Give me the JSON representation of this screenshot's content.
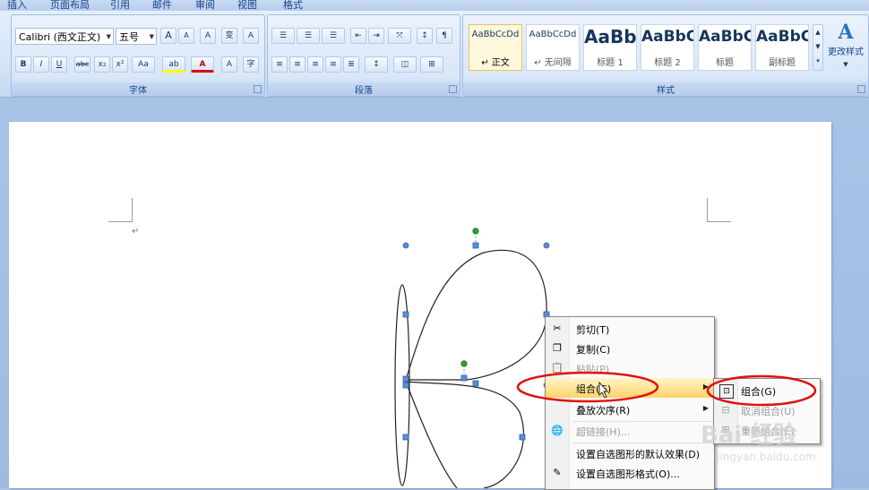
{
  "tabs": [
    "插入",
    "页面布局",
    "引用",
    "邮件",
    "审阅",
    "视图",
    "格式"
  ],
  "ribbon": {
    "font_group": {
      "title": "字体",
      "font_name": "Calibri (西文正文)",
      "font_size": "五号",
      "grow_font": "A",
      "shrink_font": "A",
      "clear_format": "A",
      "phonetic": "变",
      "border_char": "A",
      "bold": "B",
      "italic": "I",
      "underline": "U",
      "strikethrough": "abc",
      "subscript": "x₂",
      "superscript": "x²",
      "change_case": "Aa",
      "highlight": "ab",
      "font_color": "A",
      "char_shading": "A",
      "enclose": "字"
    },
    "paragraph_group": {
      "title": "段落"
    },
    "styles_group": {
      "title": "样式",
      "styles": [
        {
          "sample": "AaBbCcDd",
          "label": "↵ 正文"
        },
        {
          "sample": "AaBbCcDd",
          "label": "↵ 无间隔"
        },
        {
          "sample": "AaBb",
          "label": "标题 1"
        },
        {
          "sample": "AaBbC",
          "label": "标题 2"
        },
        {
          "sample": "AaBbC",
          "label": "标题"
        },
        {
          "sample": "AaBbC",
          "label": "副标题"
        }
      ],
      "change_styles": "更改样式"
    }
  },
  "document": {
    "paragraph_mark": "↵"
  },
  "context_menu": {
    "items": [
      {
        "label": "剪切(T)",
        "icon": "scissors-icon",
        "enabled": true
      },
      {
        "label": "复制(C)",
        "icon": "copy-icon",
        "enabled": true
      },
      {
        "label": "粘贴(P)",
        "icon": "paste-icon",
        "enabled": false
      },
      {
        "label": "组合(G)",
        "icon": "",
        "enabled": true,
        "submenu": true,
        "highlighted": true
      },
      {
        "label": "叠放次序(R)",
        "icon": "",
        "enabled": true,
        "submenu": true
      },
      {
        "label": "超链接(H)...",
        "icon": "hyperlink-icon",
        "enabled": false
      },
      {
        "label": "设置自选图形的默认效果(D)",
        "icon": "",
        "enabled": true
      },
      {
        "label": "设置自选图形格式(O)...",
        "icon": "format-shape-icon",
        "enabled": true
      }
    ]
  },
  "submenu": {
    "items": [
      {
        "label": "组合(G)",
        "icon": "group-icon",
        "enabled": true
      },
      {
        "label": "取消组合(U)",
        "icon": "ungroup-icon",
        "enabled": false
      },
      {
        "label": "重新组合(E)",
        "icon": "regroup-icon",
        "enabled": false
      }
    ]
  },
  "watermark": {
    "brand": "Bai 经验",
    "url": "jingyan.baidu.com"
  },
  "colors": {
    "annotation_red": "#e01010",
    "highlight": "#ffd36b",
    "handle": "#4f81bd",
    "rotate_handle": "#2aa52a"
  }
}
